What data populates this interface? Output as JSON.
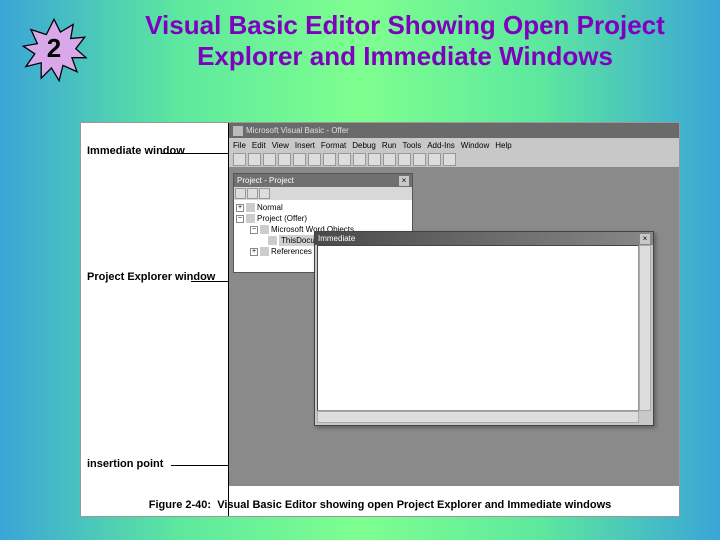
{
  "badge": {
    "number": "2"
  },
  "heading": "Visual Basic Editor Showing Open Project Explorer and Immediate Windows",
  "labels": {
    "immediate": "Immediate window",
    "project_explorer": "Project Explorer window",
    "insertion_point": "insertion point"
  },
  "vbe": {
    "title": "Microsoft Visual Basic - Offer",
    "menu": [
      "File",
      "Edit",
      "View",
      "Insert",
      "Format",
      "Debug",
      "Run",
      "Tools",
      "Add-Ins",
      "Window",
      "Help"
    ]
  },
  "project_explorer": {
    "title": "Project - Project",
    "tree": {
      "normal": "Normal",
      "project": "Project (Offer)",
      "word_objects": "Microsoft Word Objects",
      "this_document": "ThisDocument",
      "references": "References"
    }
  },
  "immediate": {
    "title": "Immediate"
  },
  "caption": "Figure 2-40:  Visual Basic Editor showing open Project Explorer and Immediate windows"
}
